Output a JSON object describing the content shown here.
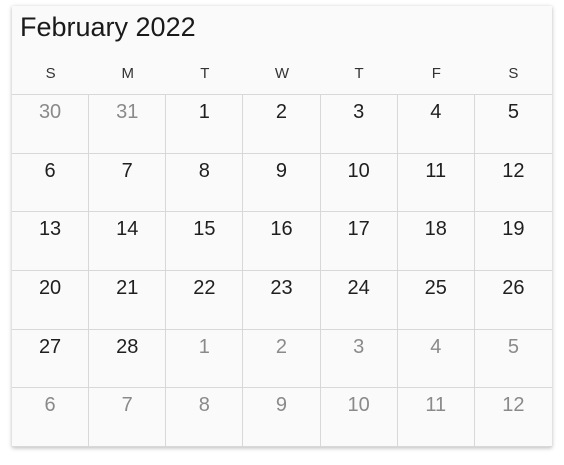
{
  "calendar": {
    "title": "February 2022",
    "weekdays": [
      "S",
      "M",
      "T",
      "W",
      "T",
      "F",
      "S"
    ],
    "days": [
      {
        "label": "30",
        "current_month": false
      },
      {
        "label": "31",
        "current_month": false
      },
      {
        "label": "1",
        "current_month": true
      },
      {
        "label": "2",
        "current_month": true
      },
      {
        "label": "3",
        "current_month": true
      },
      {
        "label": "4",
        "current_month": true
      },
      {
        "label": "5",
        "current_month": true
      },
      {
        "label": "6",
        "current_month": true
      },
      {
        "label": "7",
        "current_month": true
      },
      {
        "label": "8",
        "current_month": true
      },
      {
        "label": "9",
        "current_month": true
      },
      {
        "label": "10",
        "current_month": true
      },
      {
        "label": "11",
        "current_month": true
      },
      {
        "label": "12",
        "current_month": true
      },
      {
        "label": "13",
        "current_month": true
      },
      {
        "label": "14",
        "current_month": true
      },
      {
        "label": "15",
        "current_month": true
      },
      {
        "label": "16",
        "current_month": true
      },
      {
        "label": "17",
        "current_month": true
      },
      {
        "label": "18",
        "current_month": true
      },
      {
        "label": "19",
        "current_month": true
      },
      {
        "label": "20",
        "current_month": true
      },
      {
        "label": "21",
        "current_month": true
      },
      {
        "label": "22",
        "current_month": true
      },
      {
        "label": "23",
        "current_month": true
      },
      {
        "label": "24",
        "current_month": true
      },
      {
        "label": "25",
        "current_month": true
      },
      {
        "label": "26",
        "current_month": true
      },
      {
        "label": "27",
        "current_month": true
      },
      {
        "label": "28",
        "current_month": true
      },
      {
        "label": "1",
        "current_month": false
      },
      {
        "label": "2",
        "current_month": false
      },
      {
        "label": "3",
        "current_month": false
      },
      {
        "label": "4",
        "current_month": false
      },
      {
        "label": "5",
        "current_month": false
      },
      {
        "label": "6",
        "current_month": false
      },
      {
        "label": "7",
        "current_month": false
      },
      {
        "label": "8",
        "current_month": false
      },
      {
        "label": "9",
        "current_month": false
      },
      {
        "label": "10",
        "current_month": false
      },
      {
        "label": "11",
        "current_month": false
      },
      {
        "label": "12",
        "current_month": false
      }
    ]
  }
}
